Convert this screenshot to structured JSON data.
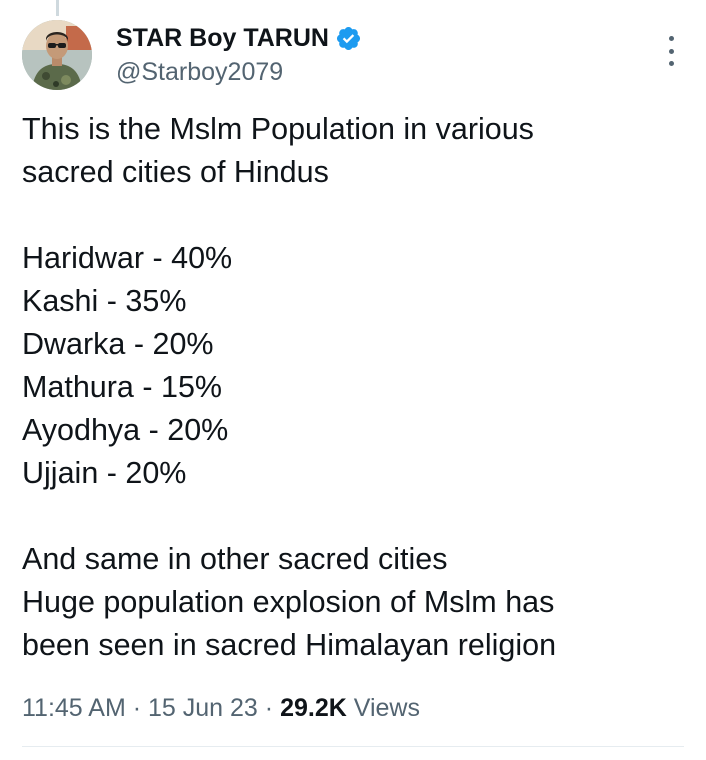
{
  "author": {
    "display_name": "STAR Boy TARUN",
    "handle": "@Starboy2079",
    "verified": true
  },
  "tweet": {
    "lines": [
      "This is the Mslm Population in various",
      "sacred cities of Hindus",
      "",
      "Haridwar - 40%",
      "Kashi - 35%",
      "Dwarka - 20%",
      "Mathura - 15%",
      "Ayodhya - 20%",
      "Ujjain - 20%",
      "",
      "And same in other sacred cities",
      "Huge population explosion of Mslm has",
      "been seen in sacred Himalayan religion"
    ]
  },
  "meta": {
    "time": "11:45 AM",
    "date": "15 Jun 23",
    "views_count": "29.2K",
    "views_label": "Views",
    "separator": "·"
  },
  "colors": {
    "verified_badge": "#1d9bf0",
    "secondary_text": "#536471",
    "primary_text": "#0f1419"
  },
  "icons": {
    "verified": "verified-badge-icon",
    "more": "more-options-icon"
  }
}
